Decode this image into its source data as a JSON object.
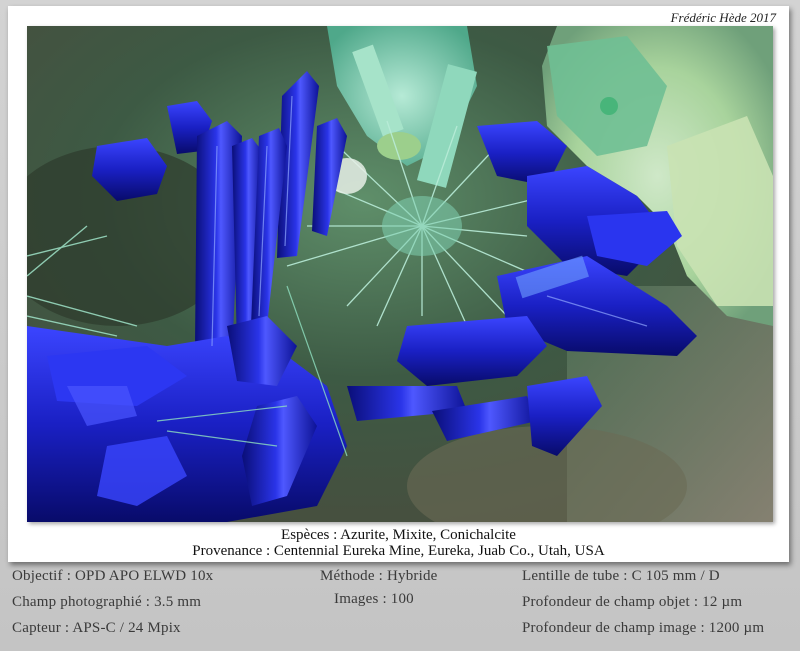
{
  "credit": "Frédéric Hède 2017",
  "caption": {
    "species": "Espèces : Azurite, Mixite, Conichalcite",
    "provenance": "Provenance : Centennial Eureka Mine, Eureka, Juab Co., Utah, USA"
  },
  "photo_specs": {
    "col1": [
      "Objectif : OPD APO ELWD 10x",
      "Champ photographié : 3.5 mm",
      "Capteur : APS-C / 24 Mpix"
    ],
    "col2": [
      "Méthode : Hybride",
      "Images : 100"
    ],
    "col3": [
      "Lentille de tube : C 105 mm / D",
      "Profondeur de champ objet : 12 µm",
      "Profondeur de champ image : 1200 µm"
    ]
  },
  "colors": {
    "azurite": "#1a1fc0",
    "mixite": "#7fd0b0",
    "conichalcite": "#9cc88a",
    "background": "#c9c9c9"
  }
}
